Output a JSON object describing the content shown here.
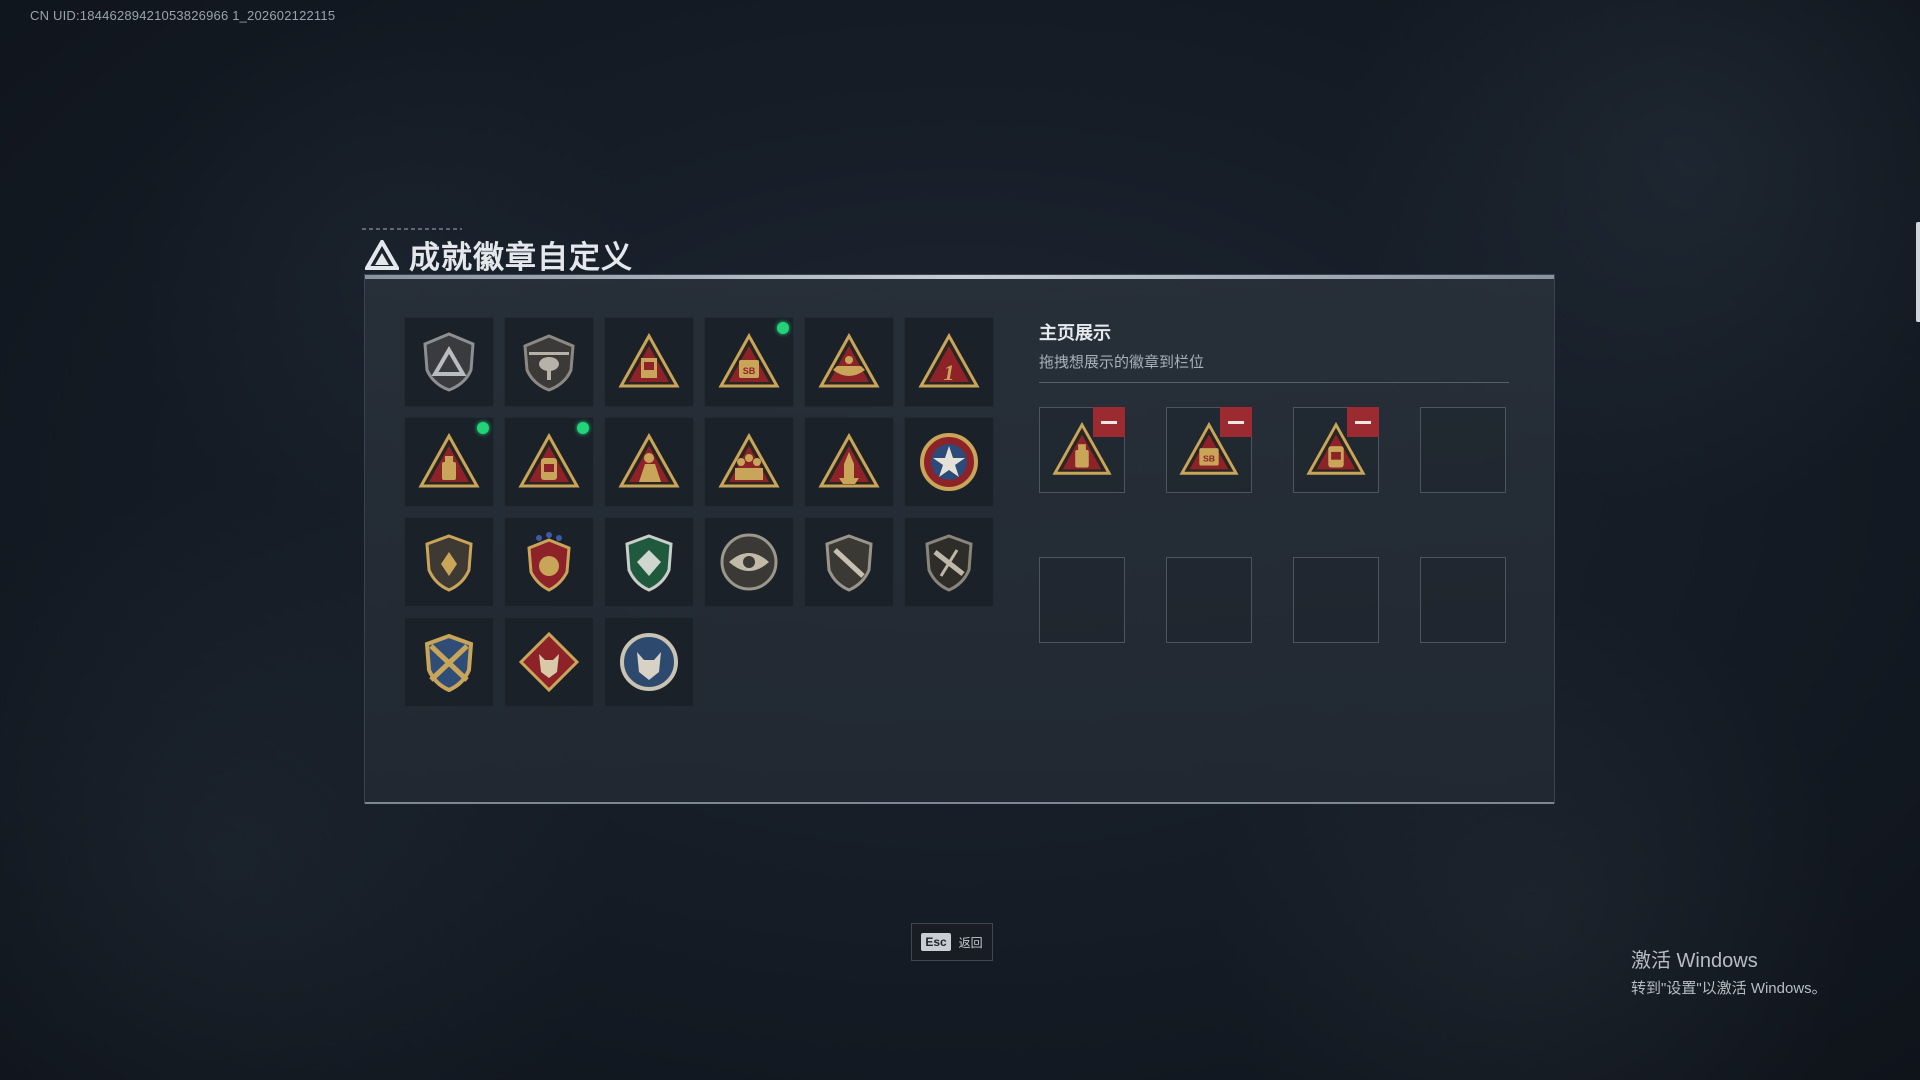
{
  "uid": "CN UID:18446289421053826966 1_202602122115",
  "title": "成就徽章自定义",
  "showcase": {
    "title": "主页展示",
    "subtitle": "拖拽想展示的徽章到栏位"
  },
  "badges": [
    {
      "icon": "shield-triangle-badge-icon",
      "new": false
    },
    {
      "icon": "helicopter-shield-badge-icon",
      "new": false
    },
    {
      "icon": "triangle-card-badge-icon",
      "new": false
    },
    {
      "icon": "triangle-sb-badge-icon",
      "new": true
    },
    {
      "icon": "triangle-ship-badge-icon",
      "new": false
    },
    {
      "icon": "triangle-number-one-badge-icon",
      "new": false
    },
    {
      "icon": "triangle-bottle-badge-icon",
      "new": true
    },
    {
      "icon": "triangle-canister-badge-icon",
      "new": true
    },
    {
      "icon": "triangle-soldier-badge-icon",
      "new": false
    },
    {
      "icon": "triangle-squad-badge-icon",
      "new": false
    },
    {
      "icon": "triangle-rocket-badge-icon",
      "new": false
    },
    {
      "icon": "star-medal-badge-icon",
      "new": false
    },
    {
      "icon": "shield-wings-badge-icon",
      "new": false
    },
    {
      "icon": "crest-stars-badge-icon",
      "new": false
    },
    {
      "icon": "green-diamond-shield-badge-icon",
      "new": false
    },
    {
      "icon": "eye-emblem-badge-icon",
      "new": false
    },
    {
      "icon": "rifle-shield-badge-icon",
      "new": false
    },
    {
      "icon": "rifle-shield-dark-badge-icon",
      "new": false
    },
    {
      "icon": "crossed-rifles-badge-icon",
      "new": false
    },
    {
      "icon": "wolf-diamond-badge-icon",
      "new": false
    },
    {
      "icon": "wolf-circle-badge-icon",
      "new": false
    }
  ],
  "slots": [
    {
      "icon": "triangle-bottle-badge-icon",
      "filled": true
    },
    {
      "icon": "triangle-sb-badge-icon",
      "filled": true
    },
    {
      "icon": "triangle-canister-badge-icon",
      "filled": true
    },
    {
      "icon": "",
      "filled": false
    },
    {
      "icon": "",
      "filled": false
    },
    {
      "icon": "",
      "filled": false
    },
    {
      "icon": "",
      "filled": false
    },
    {
      "icon": "",
      "filled": false
    }
  ],
  "esc": {
    "key": "Esc",
    "label": "返回"
  },
  "windows": {
    "line1": "激活 Windows",
    "line2": "转到\"设置\"以激活 Windows。"
  },
  "colors": {
    "gold": "#c9a55a",
    "red": "#8e2229",
    "dark": "#2a2520",
    "new_dot": "#22d37a",
    "remove": "#9b2b31"
  }
}
